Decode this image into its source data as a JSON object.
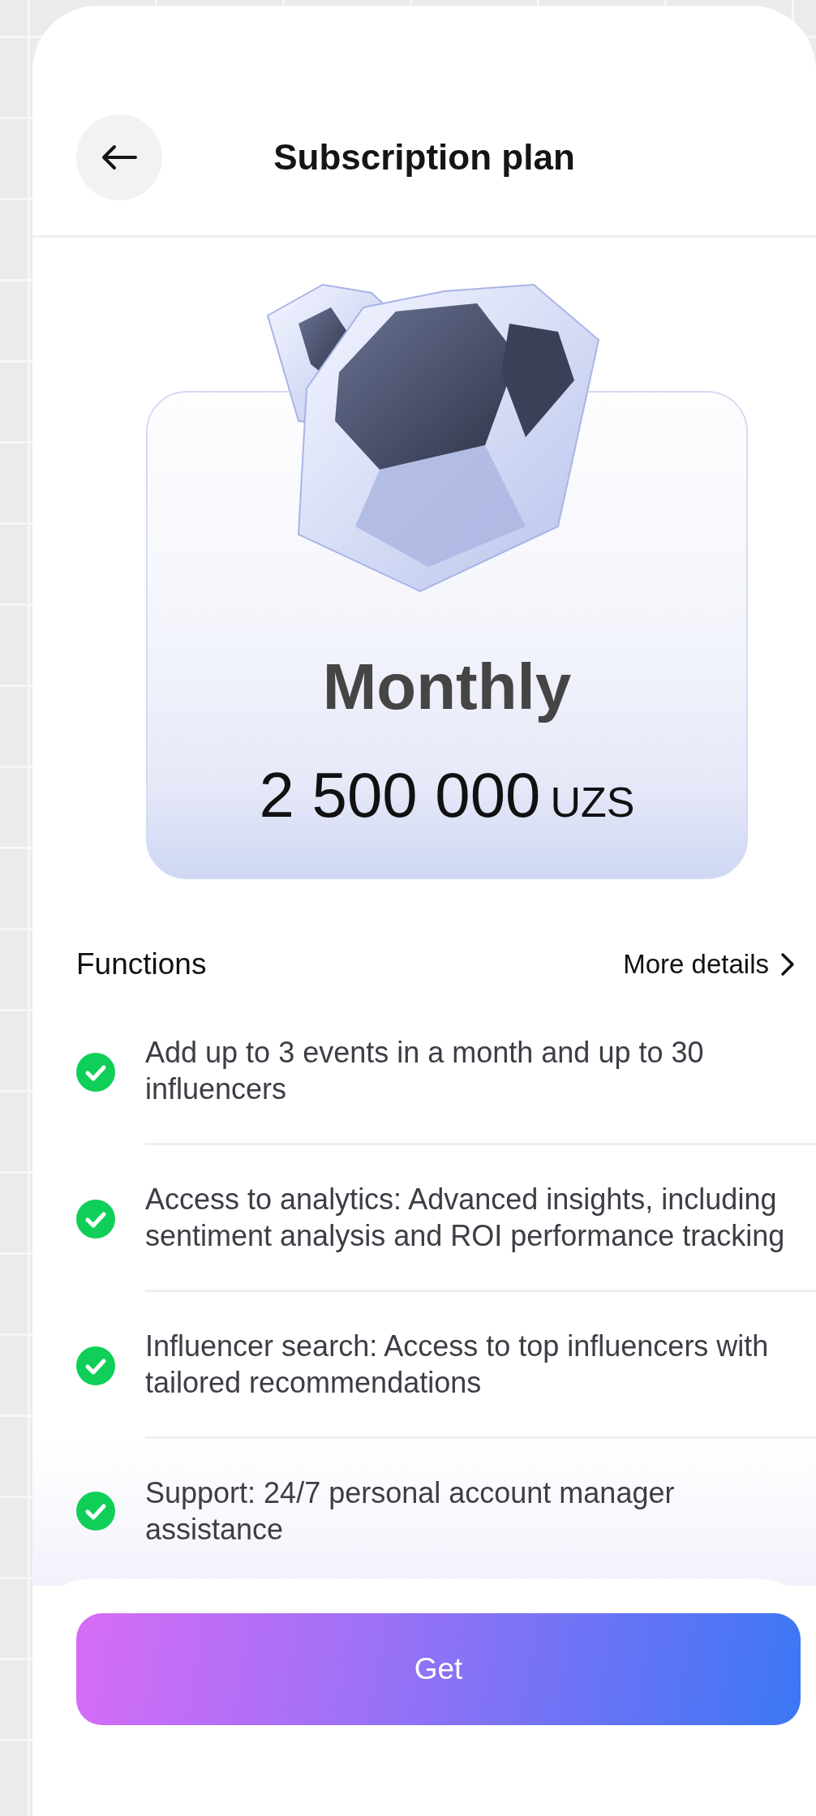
{
  "header": {
    "title": "Subscription plan"
  },
  "plan": {
    "name": "Monthly",
    "price": "2 500 000",
    "currency": "UZS"
  },
  "functions": {
    "title": "Functions",
    "more_link": "More details",
    "items": [
      "Add up to 3 events in a month and up to 30 influencers",
      "Access to analytics: Advanced insights, including sentiment analysis and ROI performance tracking",
      "Influencer search: Access to top influencers with tailored recommendations",
      "Support: 24/7 personal account manager assistance"
    ]
  },
  "action_button": "Get"
}
